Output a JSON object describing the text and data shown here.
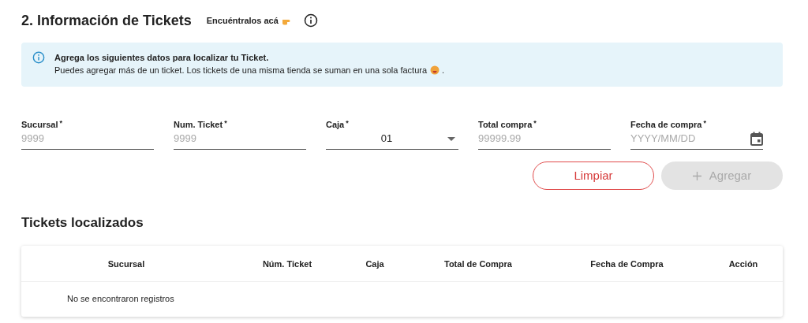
{
  "section_title": "2. Información de Tickets",
  "help_link": "Encuéntralos acá",
  "banner": {
    "title": "Agrega los siguientes datos para localizar tu Ticket.",
    "text": "Puedes agregar más de un ticket. Los tickets de una misma tienda se suman en una sola factura",
    "end": "."
  },
  "fields": [
    {
      "kind": "text",
      "label": "Sucursal",
      "required_mark": "*",
      "placeholder": "9999"
    },
    {
      "kind": "text",
      "label": "Num. Ticket",
      "required_mark": "*",
      "placeholder": "9999"
    },
    {
      "kind": "select",
      "label": "Caja",
      "required_mark": "*",
      "value": "01"
    },
    {
      "kind": "text",
      "label": "Total compra",
      "required_mark": "*",
      "placeholder": "99999.99"
    },
    {
      "kind": "date",
      "label": "Fecha de compra",
      "required_mark": "*",
      "placeholder": "YYYY/MM/DD"
    }
  ],
  "buttons": [
    {
      "kind": "outline",
      "label": "Limpiar",
      "disabled": false
    },
    {
      "kind": "add",
      "label": "Agregar",
      "disabled": true
    }
  ],
  "table": {
    "title": "Tickets localizados",
    "columns": [
      "Sucursal",
      "Núm. Ticket",
      "Caja",
      "Total de Compra",
      "Fecha de Compra",
      "Acción"
    ],
    "empty_message": "No se encontraron registros"
  }
}
